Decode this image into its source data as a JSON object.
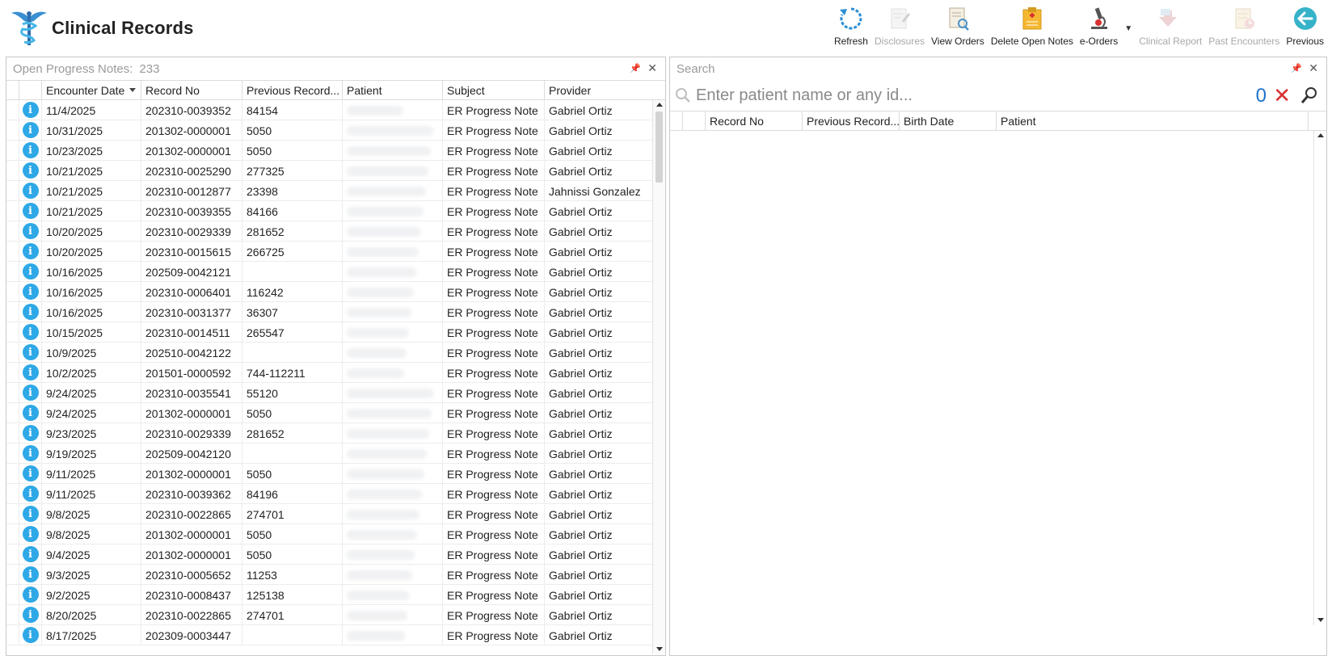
{
  "app": {
    "title": "Clinical Records"
  },
  "toolbar": {
    "refresh": "Refresh",
    "disclosures": "Disclosures",
    "view_orders": "View Orders",
    "delete_open_notes": "Delete Open Notes",
    "e_orders": "e-Orders",
    "clinical_report": "Clinical Report",
    "past_encounters": "Past Encounters",
    "previous": "Previous"
  },
  "left_panel": {
    "title": "Open Progress Notes:",
    "count": "233",
    "columns": [
      "Encounter Date",
      "Record No",
      "Previous Record...",
      "Patient",
      "Subject",
      "Provider"
    ],
    "rows": [
      [
        "11/4/2025",
        "202310-0039352",
        "84154",
        "ER Progress Note",
        "Gabriel Ortiz"
      ],
      [
        "10/31/2025",
        "201302-0000001",
        "5050",
        "ER Progress Note",
        "Gabriel Ortiz"
      ],
      [
        "10/23/2025",
        "201302-0000001",
        "5050",
        "ER Progress Note",
        "Gabriel Ortiz"
      ],
      [
        "10/21/2025",
        "202310-0025290",
        "277325",
        "ER Progress Note",
        "Gabriel Ortiz"
      ],
      [
        "10/21/2025",
        "202310-0012877",
        "23398",
        "ER Progress Note",
        "Jahnissi Gonzalez"
      ],
      [
        "10/21/2025",
        "202310-0039355",
        "84166",
        "ER Progress Note",
        "Gabriel Ortiz"
      ],
      [
        "10/20/2025",
        "202310-0029339",
        "281652",
        "ER Progress Note",
        "Gabriel Ortiz"
      ],
      [
        "10/20/2025",
        "202310-0015615",
        "266725",
        "ER Progress Note",
        "Gabriel Ortiz"
      ],
      [
        "10/16/2025",
        "202509-0042121",
        "",
        "ER Progress Note",
        "Gabriel Ortiz"
      ],
      [
        "10/16/2025",
        "202310-0006401",
        "116242",
        "ER Progress Note",
        "Gabriel Ortiz"
      ],
      [
        "10/16/2025",
        "202310-0031377",
        "36307",
        "ER Progress Note",
        "Gabriel Ortiz"
      ],
      [
        "10/15/2025",
        "202310-0014511",
        "265547",
        "ER Progress Note",
        "Gabriel Ortiz"
      ],
      [
        "10/9/2025",
        "202510-0042122",
        "",
        "ER Progress Note",
        "Gabriel Ortiz"
      ],
      [
        "10/2/2025",
        "201501-0000592",
        "744-112211",
        "ER Progress Note",
        "Gabriel Ortiz"
      ],
      [
        "9/24/2025",
        "202310-0035541",
        "55120",
        "ER Progress Note",
        "Gabriel Ortiz"
      ],
      [
        "9/24/2025",
        "201302-0000001",
        "5050",
        "ER Progress Note",
        "Gabriel Ortiz"
      ],
      [
        "9/23/2025",
        "202310-0029339",
        "281652",
        "ER Progress Note",
        "Gabriel Ortiz"
      ],
      [
        "9/19/2025",
        "202509-0042120",
        "",
        "ER Progress Note",
        "Gabriel Ortiz"
      ],
      [
        "9/11/2025",
        "201302-0000001",
        "5050",
        "ER Progress Note",
        "Gabriel Ortiz"
      ],
      [
        "9/11/2025",
        "202310-0039362",
        "84196",
        "ER Progress Note",
        "Gabriel Ortiz"
      ],
      [
        "9/8/2025",
        "202310-0022865",
        "274701",
        "ER Progress Note",
        "Gabriel Ortiz"
      ],
      [
        "9/8/2025",
        "201302-0000001",
        "5050",
        "ER Progress Note",
        "Gabriel Ortiz"
      ],
      [
        "9/4/2025",
        "201302-0000001",
        "5050",
        "ER Progress Note",
        "Gabriel Ortiz"
      ],
      [
        "9/3/2025",
        "202310-0005652",
        "11253",
        "ER Progress Note",
        "Gabriel Ortiz"
      ],
      [
        "9/2/2025",
        "202310-0008437",
        "125138",
        "ER Progress Note",
        "Gabriel Ortiz"
      ],
      [
        "8/20/2025",
        "202310-0022865",
        "274701",
        "ER Progress Note",
        "Gabriel Ortiz"
      ],
      [
        "8/17/2025",
        "202309-0003447",
        "",
        "ER Progress Note",
        "Gabriel Ortiz"
      ]
    ]
  },
  "right_panel": {
    "title": "Search",
    "search_placeholder": "Enter patient name or any id...",
    "result_count": "0",
    "columns": [
      "Record No",
      "Previous Record...",
      "Birth Date",
      "Patient"
    ]
  },
  "colors": {
    "accent_blue": "#2ea8e6",
    "count_blue": "#1e73c9",
    "clear_red": "#d83030"
  }
}
